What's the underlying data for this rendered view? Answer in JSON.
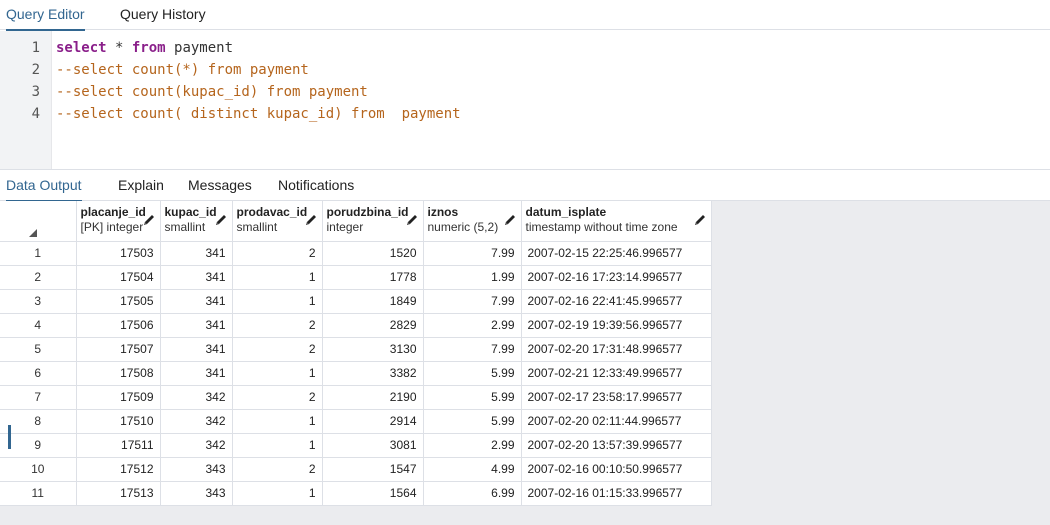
{
  "top_tabs": [
    {
      "label": "Query Editor",
      "active": true
    },
    {
      "label": "Query History",
      "active": false
    }
  ],
  "editor": {
    "lines": [
      {
        "num": "1",
        "tokens": [
          {
            "t": "select",
            "c": "kw"
          },
          {
            "t": " * ",
            "c": "plain"
          },
          {
            "t": "from",
            "c": "kw"
          },
          {
            "t": " payment",
            "c": "plain"
          }
        ]
      },
      {
        "num": "2",
        "tokens": [
          {
            "t": "--select count(*) from payment",
            "c": "comment"
          }
        ]
      },
      {
        "num": "3",
        "tokens": [
          {
            "t": "--select count(kupac_id) from payment",
            "c": "comment"
          }
        ]
      },
      {
        "num": "4",
        "tokens": [
          {
            "t": "--select count( distinct kupac_id) from  payment",
            "c": "comment"
          }
        ]
      }
    ]
  },
  "bottom_tabs": [
    {
      "label": "Data Output",
      "active": true
    },
    {
      "label": "Explain",
      "active": false
    },
    {
      "label": "Messages",
      "active": false
    },
    {
      "label": "Notifications",
      "active": false
    }
  ],
  "grid": {
    "columns": [
      {
        "name": "placanje_id",
        "type": "[PK] integer",
        "align": "num"
      },
      {
        "name": "kupac_id",
        "type": "smallint",
        "align": "num"
      },
      {
        "name": "prodavac_id",
        "type": "smallint",
        "align": "num"
      },
      {
        "name": "porudzbina_id",
        "type": "integer",
        "align": "num"
      },
      {
        "name": "iznos",
        "type": "numeric (5,2)",
        "align": "num"
      },
      {
        "name": "datum_isplate",
        "type": "timestamp without time zone",
        "align": "text"
      }
    ],
    "rows": [
      [
        "1",
        "17503",
        "341",
        "2",
        "1520",
        "7.99",
        "2007-02-15 22:25:46.996577"
      ],
      [
        "2",
        "17504",
        "341",
        "1",
        "1778",
        "1.99",
        "2007-02-16 17:23:14.996577"
      ],
      [
        "3",
        "17505",
        "341",
        "1",
        "1849",
        "7.99",
        "2007-02-16 22:41:45.996577"
      ],
      [
        "4",
        "17506",
        "341",
        "2",
        "2829",
        "2.99",
        "2007-02-19 19:39:56.996577"
      ],
      [
        "5",
        "17507",
        "341",
        "2",
        "3130",
        "7.99",
        "2007-02-20 17:31:48.996577"
      ],
      [
        "6",
        "17508",
        "341",
        "1",
        "3382",
        "5.99",
        "2007-02-21 12:33:49.996577"
      ],
      [
        "7",
        "17509",
        "342",
        "2",
        "2190",
        "5.99",
        "2007-02-17 23:58:17.996577"
      ],
      [
        "8",
        "17510",
        "342",
        "1",
        "2914",
        "5.99",
        "2007-02-20 02:11:44.996577"
      ],
      [
        "9",
        "17511",
        "342",
        "1",
        "3081",
        "2.99",
        "2007-02-20 13:57:39.996577"
      ],
      [
        "10",
        "17512",
        "343",
        "2",
        "1547",
        "4.99",
        "2007-02-16 00:10:50.996577"
      ],
      [
        "11",
        "17513",
        "343",
        "1",
        "1564",
        "6.99",
        "2007-02-16 01:15:33.996577"
      ]
    ]
  }
}
